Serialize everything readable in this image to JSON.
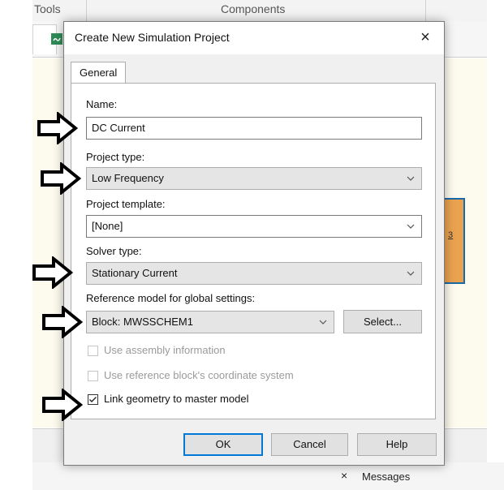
{
  "app": {
    "toolbar": {
      "tools_label": "Tools",
      "components_label": "Components"
    },
    "block_pin_label": "3",
    "messages": {
      "close_glyph": "×",
      "label": "Messages"
    }
  },
  "dialog": {
    "title": "Create New Simulation Project",
    "close_glyph": "×",
    "tabs": [
      {
        "label": "General",
        "active": true
      }
    ],
    "name": {
      "label": "Name:",
      "value": "DC Current"
    },
    "project_type": {
      "label": "Project type:",
      "value": "Low Frequency"
    },
    "project_template": {
      "label": "Project template:",
      "value": "[None]"
    },
    "solver_type": {
      "label": "Solver type:",
      "value": "Stationary Current"
    },
    "reference_model": {
      "label": "Reference model for global settings:",
      "value": "Block: MWSSCHEM1",
      "select_button": "Select..."
    },
    "checkboxes": [
      {
        "label": "Use assembly information",
        "checked": false,
        "enabled": false
      },
      {
        "label": "Use reference block's coordinate system",
        "checked": false,
        "enabled": false
      },
      {
        "label": "Link geometry to master model",
        "checked": true,
        "enabled": true
      }
    ],
    "buttons": {
      "ok": "OK",
      "cancel": "Cancel",
      "help": "Help"
    }
  },
  "colors": {
    "focus_blue": "#0078d7",
    "block_orange": "#e9a24f",
    "block_border": "#1b6aa8",
    "canvas_bg": "#fdfaee"
  },
  "icons": [
    "close-icon",
    "chevron-down-icon",
    "checkmark-icon",
    "pointer-arrow-icon"
  ]
}
